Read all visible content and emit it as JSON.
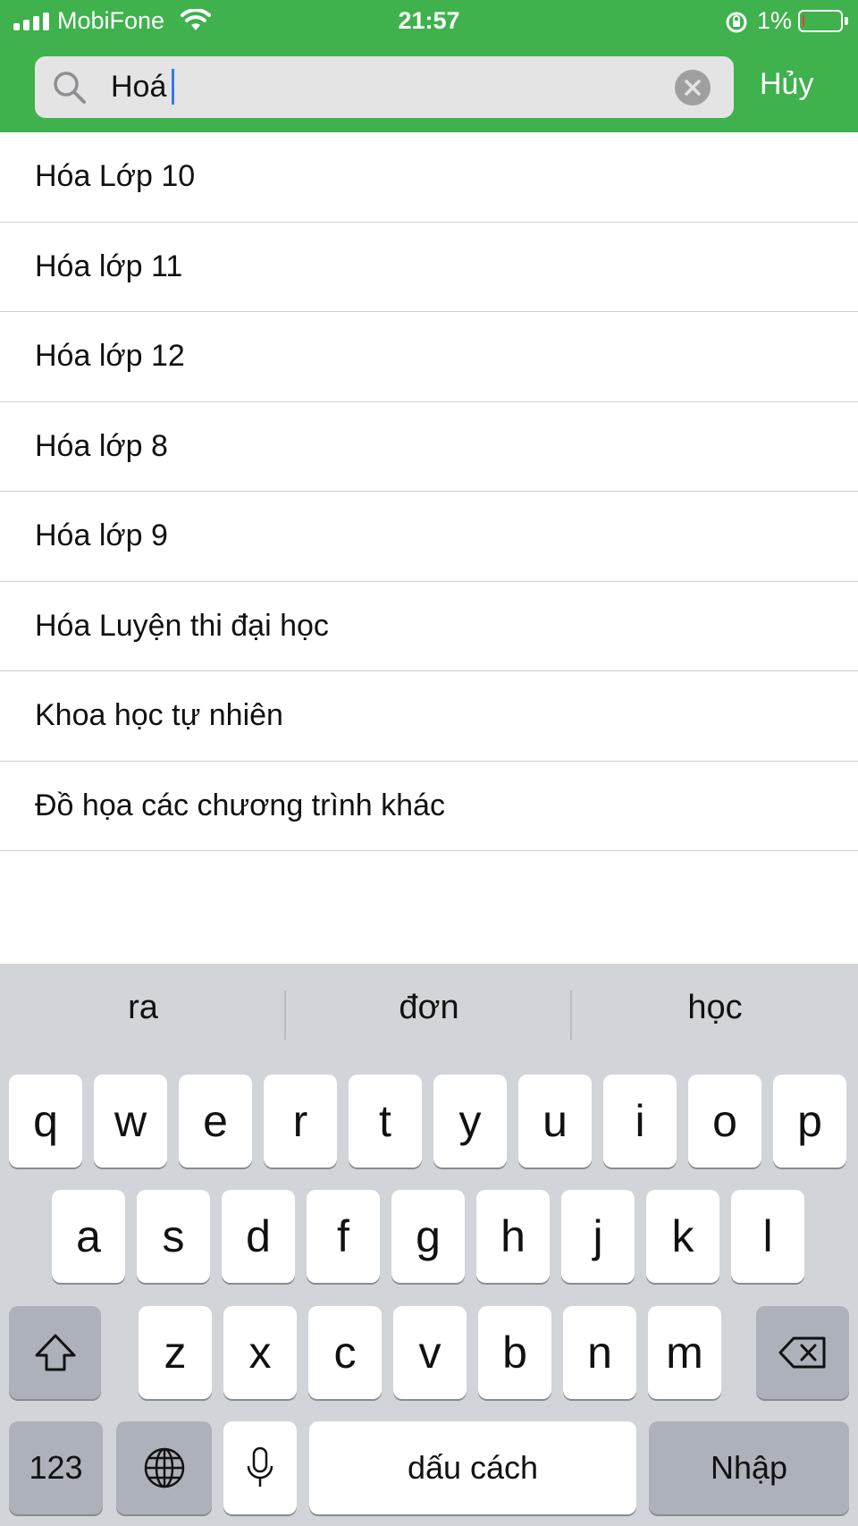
{
  "status_bar": {
    "carrier": "MobiFone",
    "time": "21:57",
    "battery_percent": "1%",
    "battery_level": 0.01,
    "icons": [
      "signal-icon",
      "wifi-icon",
      "orientation-lock-icon",
      "battery-icon"
    ]
  },
  "search": {
    "value": "Hoá",
    "clear_icon": "close-circle-icon",
    "cancel_label": "Hủy"
  },
  "results": [
    "Hóa Lớp 10",
    "Hóa lớp 11",
    "Hóa lớp 12",
    "Hóa lớp 8",
    "Hóa lớp 9",
    "Hóa Luyện thi đại học",
    "Khoa học tự nhiên",
    "Đồ họa các chương trình khác"
  ],
  "keyboard": {
    "suggestions": [
      "ra",
      "đơn",
      "học"
    ],
    "row1": [
      "q",
      "w",
      "e",
      "r",
      "t",
      "y",
      "u",
      "i",
      "o",
      "p"
    ],
    "row2": [
      "a",
      "s",
      "d",
      "f",
      "g",
      "h",
      "j",
      "k",
      "l"
    ],
    "row3": [
      "z",
      "x",
      "c",
      "v",
      "b",
      "n",
      "m"
    ],
    "numbers_label": "123",
    "space_label": "dấu cách",
    "return_label": "Nhập",
    "shift_icon": "shift-icon",
    "delete_icon": "backspace-icon",
    "globe_icon": "globe-icon",
    "mic_icon": "microphone-icon"
  },
  "colors": {
    "header_green": "#3fb14d",
    "caret_blue": "#3478f6",
    "keyboard_bg": "#d1d4d9",
    "battery_red": "#ff3b30"
  }
}
